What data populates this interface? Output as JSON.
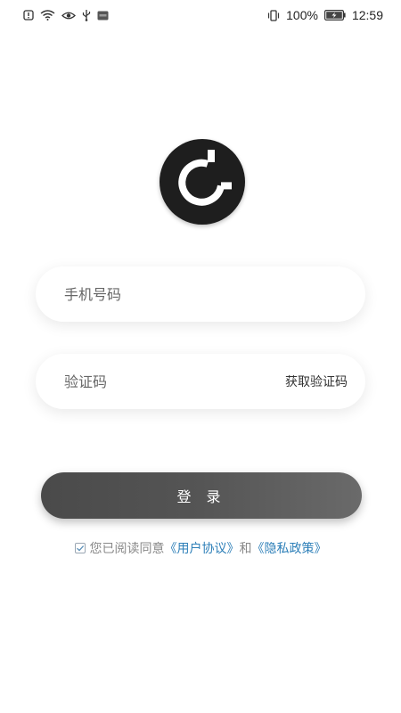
{
  "status_bar": {
    "battery_percent": "100%",
    "time": "12:59",
    "icons_left": [
      "alert-icon",
      "wifi-icon",
      "eye-icon",
      "usb-icon",
      "nfc-icon"
    ],
    "icons_right": [
      "vibrate-icon",
      "battery-icon"
    ]
  },
  "logo": {
    "icon": "app-logo-icon",
    "colors": {
      "background": "#1e1e1e",
      "ring": "#ffffff"
    }
  },
  "form": {
    "phone": {
      "placeholder": "手机号码",
      "value": ""
    },
    "code": {
      "placeholder": "验证码",
      "value": "",
      "get_code_label": "获取验证码"
    },
    "login_label": "登 录"
  },
  "agreement": {
    "checked": true,
    "prefix": "您已阅读同意",
    "user_agreement": "《用户协议》",
    "conjunction": "和",
    "privacy_policy": "《隐私政策》"
  },
  "colors": {
    "link": "#2d7fb8",
    "button": "#555555",
    "muted_text": "#888888"
  }
}
